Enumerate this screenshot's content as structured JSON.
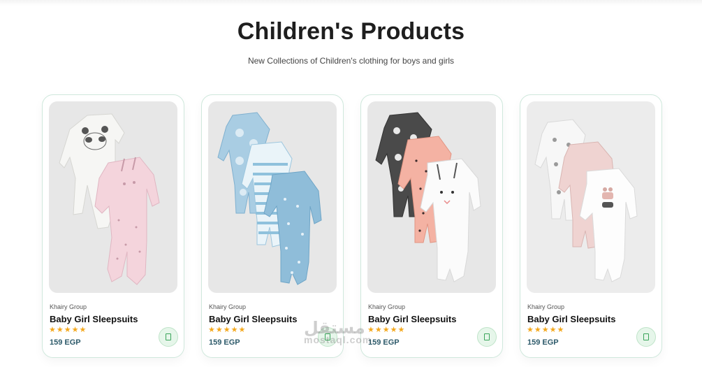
{
  "header": {
    "title": "Children's Products",
    "subtitle": "New Collections of Children's clothing for boys and girls"
  },
  "products": [
    {
      "brand": "Khairy Group",
      "name": "Baby Girl Sleepsuits",
      "rating": 5,
      "stars": "★★★★★",
      "price": "159 EGP",
      "image": "panda-and-bunny-sleepsuits"
    },
    {
      "brand": "Khairy Group",
      "name": "Baby Girl Sleepsuits",
      "rating": 5,
      "stars": "★★★★★",
      "price": "159 EGP",
      "image": "blue-elephant-striped-dotted-sleepsuits"
    },
    {
      "brand": "Khairy Group",
      "name": "Baby Girl Sleepsuits",
      "rating": 5,
      "stars": "★★★★★",
      "price": "159 EGP",
      "image": "grey-pink-white-bunny-sleepsuits"
    },
    {
      "brand": "Khairy Group",
      "name": "Baby Girl Sleepsuits",
      "rating": 5,
      "stars": "★★★★★",
      "price": "159 EGP",
      "image": "white-pink-cat-sleepsuits"
    }
  ],
  "watermark": {
    "line1": "مستقل",
    "line2": "mostaql.com"
  },
  "colors": {
    "star": "#f4a81d",
    "price": "#2d5a6a",
    "card_border": "#cfe8dc",
    "cart_button": "#e6f6ea"
  }
}
